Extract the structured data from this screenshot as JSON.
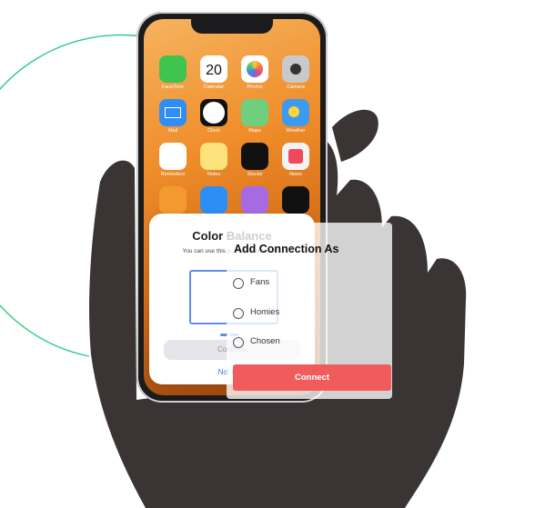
{
  "home_apps": [
    {
      "name": "FaceTime",
      "color": "#3fc44f",
      "icon": "facetime-icon"
    },
    {
      "name": "Calendar",
      "color": "#ffffff",
      "icon": "calendar-icon",
      "day": "20"
    },
    {
      "name": "Photos",
      "color": "#ffffff",
      "icon": "photos-icon"
    },
    {
      "name": "Camera",
      "color": "#c9c9cc",
      "icon": "camera-icon"
    },
    {
      "name": "Mail",
      "color": "#2f8ef3",
      "icon": "mail-icon"
    },
    {
      "name": "Clock",
      "color": "#111111",
      "icon": "clock-icon"
    },
    {
      "name": "Maps",
      "color": "#6fcf7f",
      "icon": "maps-icon"
    },
    {
      "name": "Weather",
      "color": "#3c9bf0",
      "icon": "weather-icon"
    },
    {
      "name": "Reminders",
      "color": "#ffffff",
      "icon": "reminders-icon"
    },
    {
      "name": "Notes",
      "color": "#fbe27a",
      "icon": "notes-icon"
    },
    {
      "name": "Stocks",
      "color": "#111111",
      "icon": "stocks-icon"
    },
    {
      "name": "News",
      "color": "#f3f3f3",
      "icon": "news-icon"
    },
    {
      "name": "Books",
      "color": "#f29a2e",
      "icon": "books-icon"
    },
    {
      "name": "App Store",
      "color": "#2d8ef5",
      "icon": "app-store-icon"
    },
    {
      "name": "Podcasts",
      "color": "#a66be3",
      "icon": "podcasts-icon"
    },
    {
      "name": "TV",
      "color": "#111111",
      "icon": "tv-icon"
    }
  ],
  "color_balance": {
    "title": "Color Balance",
    "subtitle": "You can use this p... television's color.",
    "continue_label": "Continue",
    "not_now_label": "Not Now"
  },
  "add_connection": {
    "title": "Add Connection As",
    "options": [
      "Fans",
      "Homies",
      "Chosen"
    ],
    "connect_label": "Connect"
  },
  "colors": {
    "accent_green": "#2ecc85",
    "connect_red": "#f25b5b",
    "link_blue": "#3478f6"
  }
}
